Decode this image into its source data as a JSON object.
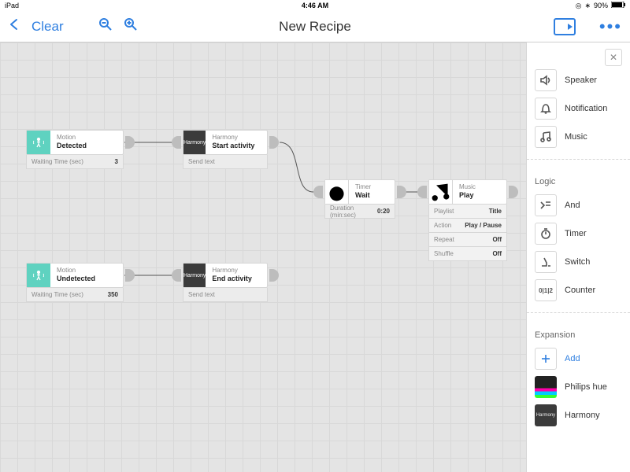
{
  "status": {
    "device": "iPad",
    "time": "4:46 AM",
    "battery": "90%"
  },
  "toolbar": {
    "clear": "Clear",
    "title": "New Recipe"
  },
  "nodes": {
    "motion1": {
      "cat": "Motion",
      "val": "Detected",
      "paramL": "Waiting Time (sec)",
      "paramV": "3"
    },
    "harmony1": {
      "cat": "Harmony",
      "val": "Start activity",
      "paramL": "Send text",
      "paramV": "",
      "icon": "Harmony"
    },
    "timer": {
      "cat": "Timer",
      "val": "Wait",
      "paramL": "Duration (min:sec)",
      "paramV": "0:20"
    },
    "music": {
      "cat": "Music",
      "val": "Play",
      "p1L": "Playlist",
      "p1V": "Title",
      "p2L": "Action",
      "p2V": "Play / Pause",
      "p3L": "Repeat",
      "p3V": "Off",
      "p4L": "Shuffle",
      "p4V": "Off"
    },
    "motion2": {
      "cat": "Motion",
      "val": "Undetected",
      "paramL": "Waiting Time (sec)",
      "paramV": "350"
    },
    "harmony2": {
      "cat": "Harmony",
      "val": "End activity",
      "paramL": "Send text",
      "paramV": "",
      "icon": "Harmony"
    }
  },
  "sidebar": {
    "top": [
      {
        "label": "Speaker"
      },
      {
        "label": "Notification"
      },
      {
        "label": "Music"
      }
    ],
    "logicHead": "Logic",
    "logic": [
      {
        "label": "And"
      },
      {
        "label": "Timer"
      },
      {
        "label": "Switch"
      },
      {
        "label": "Counter"
      }
    ],
    "expHead": "Expansion",
    "add": "Add",
    "exp": [
      {
        "label": "Philips hue"
      },
      {
        "label": "Harmony"
      }
    ]
  }
}
